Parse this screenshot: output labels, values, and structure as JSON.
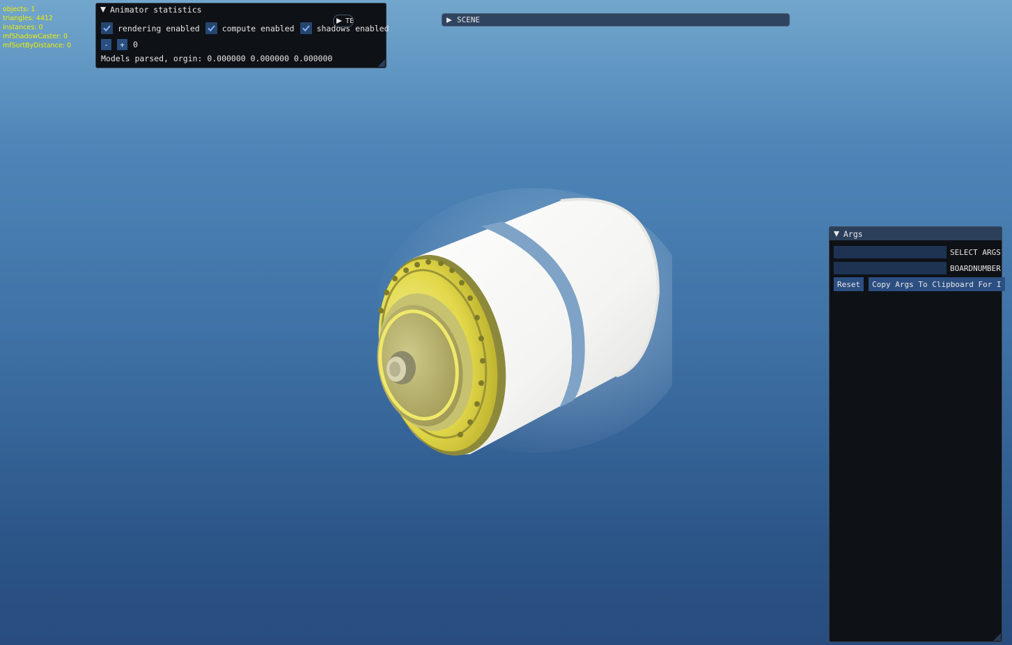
{
  "stats": {
    "objects": "objects: 1",
    "triangles": "triangles: 4412",
    "instances": "instances: 0",
    "shadow_caster": "mfShadowCaster: 0",
    "sort_by_distance": "mfSortByDistance: 0"
  },
  "animator": {
    "title": "Animator statistics",
    "rendering_label": "rendering enabled",
    "compute_label": "compute enabled",
    "shadows_label": "shadows enabled",
    "minus_label": "-",
    "plus_label": "+",
    "counter_value": "0",
    "status_text": "Models parsed, orgin: 0.000000 0.000000 0.000000",
    "te_tab_label": "TE"
  },
  "scene": {
    "title": "SCENE"
  },
  "args": {
    "title": "Args",
    "select_args_label": "SELECT ARGS",
    "boardnumber_label": "BOARDNUMBER",
    "select_args_value": "",
    "boardnumber_value": "",
    "reset_label": "Reset",
    "copy_label": "Copy Args To Clipboard For I"
  },
  "colors": {
    "stats_text": "#f0f000",
    "window_bg": "#0e1116",
    "accent": "#2a4f80",
    "checkbox_bg": "#27466e"
  }
}
